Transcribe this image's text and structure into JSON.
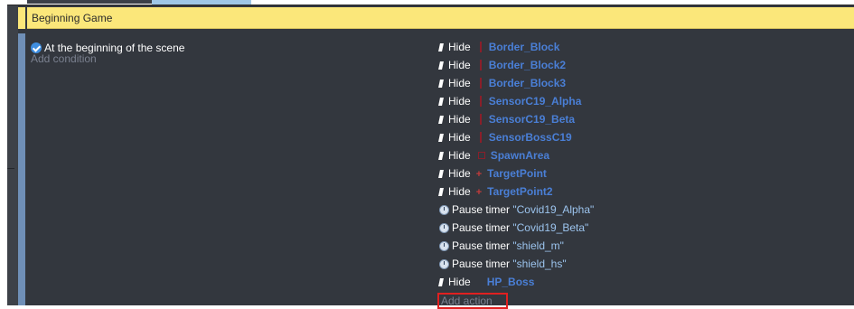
{
  "group": {
    "title": "Beginning Game"
  },
  "event": {
    "conditions": [
      {
        "label": "At the beginning of the scene",
        "icon": "scene-start-icon"
      }
    ],
    "add_condition_label": "Add condition",
    "actions": [
      {
        "verb": "Hide",
        "object": "Border_Block",
        "icon": "hide-icon",
        "object_icon": "sprite-object-icon"
      },
      {
        "verb": "Hide",
        "object": "Border_Block2",
        "icon": "hide-icon",
        "object_icon": "sprite-object-icon"
      },
      {
        "verb": "Hide",
        "object": "Border_Block3",
        "icon": "hide-icon",
        "object_icon": "sprite-object-icon"
      },
      {
        "verb": "Hide",
        "object": "SensorC19_Alpha",
        "icon": "hide-icon",
        "object_icon": "sprite-object-icon"
      },
      {
        "verb": "Hide",
        "object": "SensorC19_Beta",
        "icon": "hide-icon",
        "object_icon": "sprite-object-icon"
      },
      {
        "verb": "Hide",
        "object": "SensorBossC19",
        "icon": "hide-icon",
        "object_icon": "sprite-object-icon"
      },
      {
        "verb": "Hide",
        "object": "SpawnArea",
        "icon": "hide-icon",
        "object_icon": "area-object-icon"
      },
      {
        "verb": "Hide",
        "object": "TargetPoint",
        "icon": "hide-icon",
        "object_icon": "point-object-icon"
      },
      {
        "verb": "Hide",
        "object": "TargetPoint2",
        "icon": "hide-icon",
        "object_icon": "point-object-icon"
      },
      {
        "verb": "Pause timer",
        "object": "\"Covid19_Alpha\"",
        "icon": "timer-icon"
      },
      {
        "verb": "Pause timer",
        "object": "\"Covid19_Beta\"",
        "icon": "timer-icon"
      },
      {
        "verb": "Pause timer",
        "object": "\"shield_m\"",
        "icon": "timer-icon"
      },
      {
        "verb": "Pause timer",
        "object": "\"shield_hs\"",
        "icon": "timer-icon"
      },
      {
        "verb": "Hide",
        "object": "HP_Boss",
        "icon": "hide-icon",
        "object_icon": "text-object-icon"
      }
    ],
    "add_action_label": "Add action"
  },
  "colors": {
    "group_header": "#fbe77a",
    "editor_background": "#33373e",
    "object_name": "#4a7fd6",
    "highlight_box": "#e02020"
  }
}
